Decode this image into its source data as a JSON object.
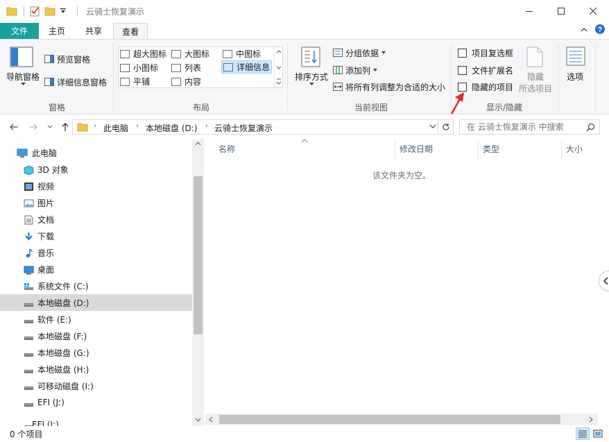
{
  "window": {
    "title": "云骑士恢复演示",
    "controls": {
      "minimize": "minimize-icon",
      "maximize": "maximize-icon",
      "close": "close-icon"
    }
  },
  "ribbon_tabs": [
    {
      "label": "文件"
    },
    {
      "label": "主页"
    },
    {
      "label": "共享"
    },
    {
      "label": "查看"
    }
  ],
  "ribbon": {
    "panes": {
      "nav_pane": "导航窗格",
      "preview_pane": "预览窗格",
      "details_pane": "详细信息窗格",
      "group": "窗格"
    },
    "layout": {
      "items": [
        "超大图标",
        "大图标",
        "中图标",
        "小图标",
        "列表",
        "详细信息",
        "平铺",
        "内容"
      ],
      "selected": "详细信息",
      "group": "布局"
    },
    "current_view": {
      "sort_by": "排序方式",
      "group_by": "分组依据",
      "add_columns": "添加列",
      "fit_columns": "将所有列调整为合适的大小",
      "group": "当前视图"
    },
    "show_hide": {
      "item_checkboxes": "项目复选框",
      "file_extensions": "文件扩展名",
      "hidden_items": "隐藏的项目",
      "hide_selected_1": "隐藏",
      "hide_selected_2": "所选项目",
      "group": "显示/隐藏"
    },
    "options": "选项"
  },
  "address_bar": {
    "crumbs": [
      "此电脑",
      "本地磁盘 (D:)",
      "云骑士恢复演示"
    ],
    "search_placeholder": "在 云骑士恢复演示 中搜索"
  },
  "nav_tree": [
    {
      "label": "此电脑",
      "icon": "this-pc-icon"
    },
    {
      "label": "3D 对象",
      "icon": "3d-objects-icon"
    },
    {
      "label": "视频",
      "icon": "video-icon"
    },
    {
      "label": "图片",
      "icon": "pictures-icon"
    },
    {
      "label": "文档",
      "icon": "documents-icon"
    },
    {
      "label": "下载",
      "icon": "download-icon"
    },
    {
      "label": "音乐",
      "icon": "music-icon"
    },
    {
      "label": "桌面",
      "icon": "desktop-icon"
    },
    {
      "label": "系统文件 (C:)",
      "icon": "system-drive-icon"
    },
    {
      "label": "本地磁盘 (D:)",
      "icon": "drive-icon",
      "selected": true
    },
    {
      "label": "软件 (E:)",
      "icon": "drive-icon"
    },
    {
      "label": "本地磁盘 (F:)",
      "icon": "drive-icon"
    },
    {
      "label": "本地磁盘 (G:)",
      "icon": "drive-icon"
    },
    {
      "label": "本地磁盘 (H:)",
      "icon": "drive-icon"
    },
    {
      "label": "可移动磁盘 (I:)",
      "icon": "removable-drive-icon"
    },
    {
      "label": "EFI (J:)",
      "icon": "drive-icon"
    },
    {
      "label": "EFI (J:)",
      "icon": "drive-icon"
    }
  ],
  "columns": [
    "名称",
    "修改日期",
    "类型",
    "大小"
  ],
  "empty_message": "该文件夹为空。",
  "status": {
    "item_count": "0 个项目"
  },
  "colors": {
    "file_tab": "#19a1a0",
    "selected_layout": "#cde8ff",
    "annotation_arrow": "#e8262a"
  }
}
